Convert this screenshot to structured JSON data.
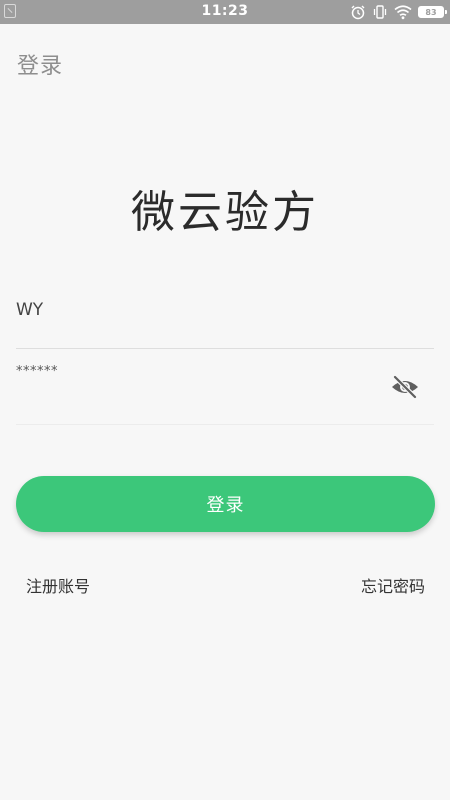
{
  "status_bar": {
    "time": "11:23",
    "battery": "83",
    "icons": [
      "notification-icon",
      "alarm-icon",
      "vibrate-icon",
      "wifi-icon",
      "battery-icon"
    ]
  },
  "header": {
    "title": "登录"
  },
  "app": {
    "title": "微云验方"
  },
  "form": {
    "username_value": "WY",
    "password_value": "******",
    "password_toggle_icon": "eye-off-icon",
    "login_label": "登录"
  },
  "links": {
    "register_label": "注册账号",
    "forgot_label": "忘记密码"
  },
  "colors": {
    "status_bar": "#9e9e9e",
    "background": "#f7f7f7",
    "accent": "#3cc77a"
  }
}
